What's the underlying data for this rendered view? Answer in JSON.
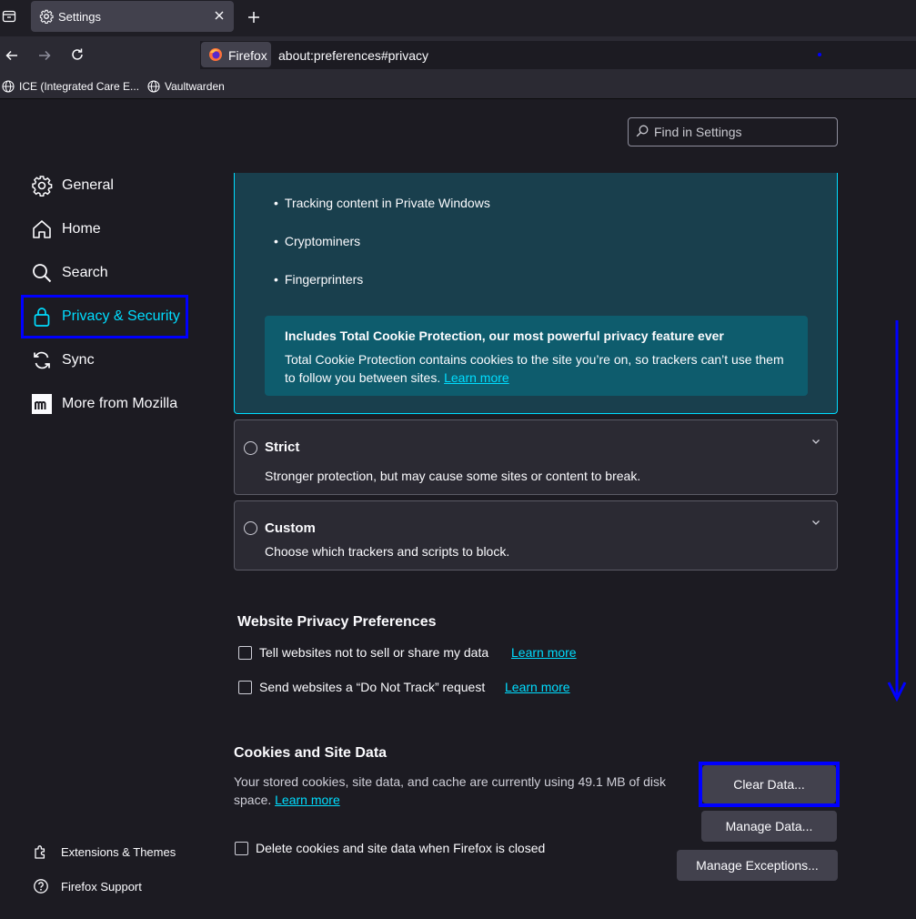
{
  "tab": {
    "title": "Settings"
  },
  "urlbar": {
    "identity_label": "Firefox",
    "url": "about:preferences#privacy"
  },
  "bookmarks": [
    {
      "label": "ICE (Integrated Care E..."
    },
    {
      "label": "Vaultwarden"
    }
  ],
  "search": {
    "placeholder": "Find in Settings"
  },
  "sidebar": {
    "items": [
      {
        "label": "General",
        "icon": "gear-icon"
      },
      {
        "label": "Home",
        "icon": "home-icon"
      },
      {
        "label": "Search",
        "icon": "search-icon"
      },
      {
        "label": "Privacy & Security",
        "icon": "lock-icon",
        "selected": true
      },
      {
        "label": "Sync",
        "icon": "sync-icon"
      },
      {
        "label": "More from Mozilla",
        "icon": "mozilla-icon"
      }
    ],
    "footer": [
      {
        "label": "Extensions & Themes",
        "icon": "puzzle-icon"
      },
      {
        "label": "Firefox Support",
        "icon": "help-icon"
      }
    ]
  },
  "standard": {
    "bullets": [
      "Tracking content in Private Windows",
      "Cryptominers",
      "Fingerprinters"
    ],
    "tcp_title": "Includes Total Cookie Protection, our most powerful privacy feature ever",
    "tcp_body": "Total Cookie Protection contains cookies to the site you’re on, so trackers can’t use them to follow you between sites.",
    "tcp_link": "Learn more"
  },
  "strict": {
    "title": "Strict",
    "desc": "Stronger protection, but may cause some sites or content to break."
  },
  "custom": {
    "title": "Custom",
    "desc": "Choose which trackers and scripts to block."
  },
  "website_privacy": {
    "heading": "Website Privacy Preferences",
    "items": [
      {
        "label": "Tell websites not to sell or share my data",
        "link": "Learn more",
        "checked": false
      },
      {
        "label": "Send websites a “Do Not Track” request",
        "link": "Learn more",
        "checked": false
      }
    ]
  },
  "cookies": {
    "heading": "Cookies and Site Data",
    "desc": "Your stored cookies, site data, and cache are currently using 49.1 MB of disk space.",
    "link": "Learn more",
    "clear_button": "Clear Data...",
    "manage_data_button": "Manage Data...",
    "manage_exceptions_button": "Manage Exceptions...",
    "delete_on_close_label": "Delete cookies and site data when Firefox is closed",
    "delete_on_close_checked": false
  },
  "colors": {
    "accent": "#00ddff",
    "annotation": "#0000ff",
    "background": "#1c1b22"
  }
}
